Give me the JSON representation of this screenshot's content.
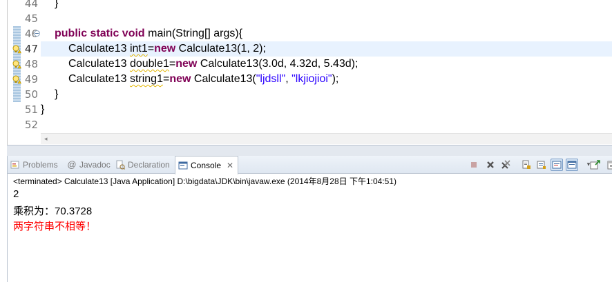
{
  "editor": {
    "line_numbers": [
      "44",
      "45",
      "46",
      "47",
      "48",
      "49",
      "50",
      "51",
      "52"
    ],
    "current_line": "47",
    "lines": {
      "l44": "}",
      "l46": {
        "kw": "public static void",
        "rest": " main(String[] args){"
      },
      "l47": {
        "p1": "Calculate13 ",
        "var": "int1",
        "p2": "=",
        "kw": "new",
        "p3": " Calculate13(1, 2);"
      },
      "l48": {
        "p1": "Calculate13 ",
        "var": "double1",
        "p2": "=",
        "kw": "new",
        "p3": " Calculate13(3.0d, 4.32d, 5.43d);"
      },
      "l49": {
        "p1": "Calculate13 ",
        "var": "string1",
        "p2": "=",
        "kw": "new",
        "p3": " Calculate13(",
        "s1": "\"ljdsll\"",
        "sep": ", ",
        "s2": "\"lkjiojioi\"",
        "p4": ");"
      },
      "l50": "}",
      "l51": "}"
    }
  },
  "console_view": {
    "tabs": [
      {
        "label": "Problems",
        "icon": "problems-icon"
      },
      {
        "label": "Javadoc",
        "icon": "at-icon"
      },
      {
        "label": "Declaration",
        "icon": "declaration-icon"
      },
      {
        "label": "Console",
        "icon": "console-icon",
        "active": true
      }
    ],
    "status_line": "<terminated> Calculate13 [Java Application] D:\\bigdata\\JDK\\bin\\javaw.exe (2014年8月28日 下午1:04:51)",
    "output": [
      {
        "text": "2",
        "color": "#000000"
      },
      {
        "text": "乘积为：70.3728",
        "color": "#000000"
      },
      {
        "text": "两字符串不相等！",
        "color": "#ff0000"
      }
    ],
    "toolbar_icons": [
      "terminate-icon",
      "remove-launch-icon",
      "remove-all-terminated-icon",
      "scroll-lock-icon",
      "show-on-stdout-icon",
      "show-on-stderr-icon",
      "pin-console-icon",
      "display-selected-console-icon",
      "open-console-icon",
      "minimize-icon"
    ]
  },
  "colors": {
    "keyword": "#7f0055",
    "string": "#2a00ff",
    "current_line_bg": "#e8f2fe",
    "stderr": "#ff0000"
  }
}
